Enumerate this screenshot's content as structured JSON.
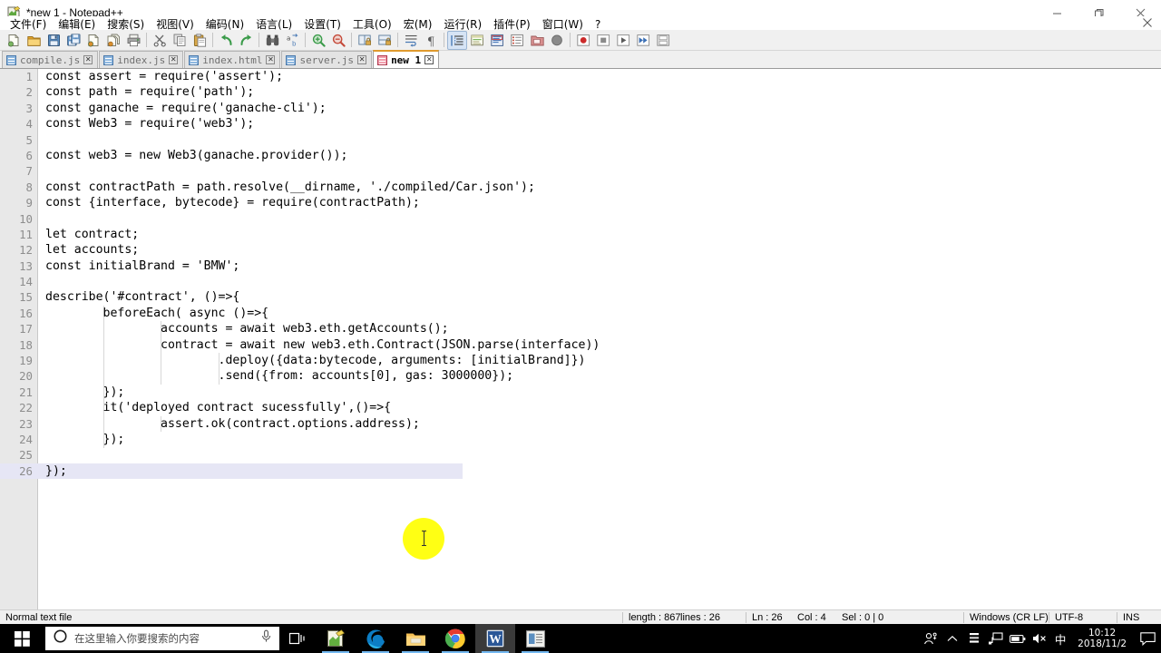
{
  "window": {
    "title": "*new 1 - Notepad++",
    "minimize_label": "—",
    "restore_label": "❐",
    "close_label": "✕",
    "doc_close_label": "✕"
  },
  "menu": {
    "items": [
      {
        "label": "文件(F)",
        "name": "menu-file"
      },
      {
        "label": "编辑(E)",
        "name": "menu-edit"
      },
      {
        "label": "搜索(S)",
        "name": "menu-search"
      },
      {
        "label": "视图(V)",
        "name": "menu-view"
      },
      {
        "label": "编码(N)",
        "name": "menu-encoding"
      },
      {
        "label": "语言(L)",
        "name": "menu-language"
      },
      {
        "label": "设置(T)",
        "name": "menu-settings"
      },
      {
        "label": "工具(O)",
        "name": "menu-tools"
      },
      {
        "label": "宏(M)",
        "name": "menu-macro"
      },
      {
        "label": "运行(R)",
        "name": "menu-run"
      },
      {
        "label": "插件(P)",
        "name": "menu-plugins"
      },
      {
        "label": "窗口(W)",
        "name": "menu-window"
      },
      {
        "label": "?",
        "name": "menu-help"
      }
    ]
  },
  "toolbar": {
    "buttons": [
      {
        "name": "new-file-icon",
        "kind": "doc",
        "accent": "#7bb661"
      },
      {
        "name": "open-file-icon",
        "kind": "folder",
        "accent": "#e8b24a"
      },
      {
        "name": "save-icon",
        "kind": "floppy",
        "accent": "#5a8fc4"
      },
      {
        "name": "save-all-icon",
        "kind": "floppy2",
        "accent": "#5a8fc4"
      },
      {
        "name": "close-file-icon",
        "kind": "doc",
        "accent": "#d98f2e"
      },
      {
        "name": "close-all-files-icon",
        "kind": "doc2",
        "accent": "#d98f2e"
      },
      {
        "name": "print-icon",
        "kind": "printer",
        "accent": "#8a8a8a"
      },
      {
        "name": "separator-1",
        "kind": "sep"
      },
      {
        "name": "cut-icon",
        "kind": "scissors",
        "accent": "#7a7a7a"
      },
      {
        "name": "copy-icon",
        "kind": "copy",
        "accent": "#b8b8b8"
      },
      {
        "name": "paste-icon",
        "kind": "paste",
        "accent": "#d9a84a"
      },
      {
        "name": "separator-2",
        "kind": "sep"
      },
      {
        "name": "undo-icon",
        "kind": "undo",
        "accent": "#3b9b4a"
      },
      {
        "name": "redo-icon",
        "kind": "redo",
        "accent": "#3b9b4a"
      },
      {
        "name": "separator-3",
        "kind": "sep"
      },
      {
        "name": "find-icon",
        "kind": "binocular",
        "accent": "#5a5a5a"
      },
      {
        "name": "replace-icon",
        "kind": "replace",
        "accent": "#4a7ab5"
      },
      {
        "name": "separator-4",
        "kind": "sep"
      },
      {
        "name": "zoom-in-icon",
        "kind": "magplus",
        "accent": "#3b9b4a"
      },
      {
        "name": "zoom-out-icon",
        "kind": "magminus",
        "accent": "#c44a3a"
      },
      {
        "name": "separator-5",
        "kind": "sep"
      },
      {
        "name": "sync-vertical-icon",
        "kind": "lockpane",
        "accent": "#d9a84a"
      },
      {
        "name": "sync-horizontal-icon",
        "kind": "lockpane2",
        "accent": "#d9a84a"
      },
      {
        "name": "separator-6",
        "kind": "sep"
      },
      {
        "name": "word-wrap-icon",
        "kind": "wrap",
        "accent": "#4a7ab5"
      },
      {
        "name": "show-all-chars-icon",
        "kind": "pilcrow",
        "accent": "#5a5a5a"
      },
      {
        "name": "separator-7",
        "kind": "sep"
      },
      {
        "name": "indent-guide-icon",
        "kind": "indent",
        "accent": "#4a7ab5",
        "active": true
      },
      {
        "name": "user-defined-dialog-icon",
        "kind": "udl",
        "accent": "#7bb661"
      },
      {
        "name": "document-map-icon",
        "kind": "map",
        "accent": "#3b6fb5"
      },
      {
        "name": "function-list-icon",
        "kind": "funclist",
        "accent": "#c44a3a"
      },
      {
        "name": "folder-as-workspace-icon",
        "kind": "workspace",
        "accent": "#d98f8f"
      },
      {
        "name": "monitoring-icon",
        "kind": "circle",
        "accent": "#8a8a8a"
      },
      {
        "name": "separator-8",
        "kind": "sep"
      },
      {
        "name": "record-macro-icon",
        "kind": "record",
        "accent": "#cc2b2b"
      },
      {
        "name": "stop-macro-icon",
        "kind": "stop",
        "accent": "#8a8a8a"
      },
      {
        "name": "play-macro-icon",
        "kind": "play",
        "accent": "#5a5a5a"
      },
      {
        "name": "play-multiple-icon",
        "kind": "playmulti",
        "accent": "#3b6fb5"
      },
      {
        "name": "save-macro-icon",
        "kind": "savemacro",
        "accent": "#8a8a8a"
      }
    ]
  },
  "tabs": [
    {
      "label": "compile.js",
      "active": false,
      "name": "tab-compile-js"
    },
    {
      "label": "index.js",
      "active": false,
      "name": "tab-index-js"
    },
    {
      "label": "index.html",
      "active": false,
      "name": "tab-index-html"
    },
    {
      "label": "server.js",
      "active": false,
      "name": "tab-server-js"
    },
    {
      "label": "new 1",
      "active": true,
      "name": "tab-new-1"
    }
  ],
  "editor": {
    "current_line": 26,
    "lines": [
      {
        "n": "1",
        "t": "const assert = require('assert');"
      },
      {
        "n": "2",
        "t": "const path = require('path');"
      },
      {
        "n": "3",
        "t": "const ganache = require('ganache-cli');"
      },
      {
        "n": "4",
        "t": "const Web3 = require('web3');"
      },
      {
        "n": "5",
        "t": ""
      },
      {
        "n": "6",
        "t": "const web3 = new Web3(ganache.provider());"
      },
      {
        "n": "7",
        "t": ""
      },
      {
        "n": "8",
        "t": "const contractPath = path.resolve(__dirname, './compiled/Car.json');"
      },
      {
        "n": "9",
        "t": "const {interface, bytecode} = require(contractPath);"
      },
      {
        "n": "10",
        "t": ""
      },
      {
        "n": "11",
        "t": "let contract;"
      },
      {
        "n": "12",
        "t": "let accounts;"
      },
      {
        "n": "13",
        "t": "const initialBrand = 'BMW';"
      },
      {
        "n": "14",
        "t": ""
      },
      {
        "n": "15",
        "t": "describe('#contract', ()=>{"
      },
      {
        "n": "16",
        "t": "        beforeEach( async ()=>{"
      },
      {
        "n": "17",
        "t": "                accounts = await web3.eth.getAccounts();"
      },
      {
        "n": "18",
        "t": "                contract = await new web3.eth.Contract(JSON.parse(interface))"
      },
      {
        "n": "19",
        "t": "                        .deploy({data:bytecode, arguments: [initialBrand]})"
      },
      {
        "n": "20",
        "t": "                        .send({from: accounts[0], gas: 3000000});"
      },
      {
        "n": "21",
        "t": "        });"
      },
      {
        "n": "22",
        "t": "        it('deployed contract sucessfully',()=>{"
      },
      {
        "n": "23",
        "t": "                assert.ok(contract.options.address);"
      },
      {
        "n": "24",
        "t": "        });"
      },
      {
        "n": "25",
        "t": ""
      },
      {
        "n": "26",
        "t": "});"
      }
    ]
  },
  "statusbar": {
    "filetype": "Normal text file",
    "length": "length : 867",
    "lines": "lines : 26",
    "ln": "Ln : 26",
    "col": "Col : 4",
    "sel": "Sel : 0 | 0",
    "eol": "Windows (CR LF)",
    "encoding": "UTF-8",
    "insert_mode": "INS"
  },
  "taskbar": {
    "start_name": "start-button",
    "search_placeholder": "在这里输入你要搜索的内容",
    "cortana_icon": "cortana-circle-icon",
    "mic_icon": "microphone-icon",
    "taskview_icon": "task-view-icon",
    "apps": [
      {
        "name": "taskbar-notepadpp",
        "label": "Notepad++",
        "running": true,
        "focused": false
      },
      {
        "name": "taskbar-edge",
        "label": "Microsoft Edge",
        "running": true,
        "focused": false
      },
      {
        "name": "taskbar-file-explorer",
        "label": "File Explorer",
        "running": true,
        "focused": false
      },
      {
        "name": "taskbar-chrome",
        "label": "Google Chrome",
        "running": true,
        "focused": false
      },
      {
        "name": "taskbar-word",
        "label": "Word",
        "running": true,
        "focused": true
      },
      {
        "name": "taskbar-app6",
        "label": "App",
        "running": true,
        "focused": false
      }
    ],
    "tray": {
      "people_icon": "people-icon",
      "chevron_icon": "⌃",
      "ime_label": "中",
      "time": "10:12",
      "date": "2018/11/2",
      "notification_icon": "action-center-icon"
    }
  },
  "colors": {
    "accent_tab": "#e09a2e",
    "current_line": "#e6e6f5",
    "gutter_bg": "#e8e8e8",
    "toolbar_bg": "#f0f0f0",
    "cursor_halo": "#ffff00"
  }
}
